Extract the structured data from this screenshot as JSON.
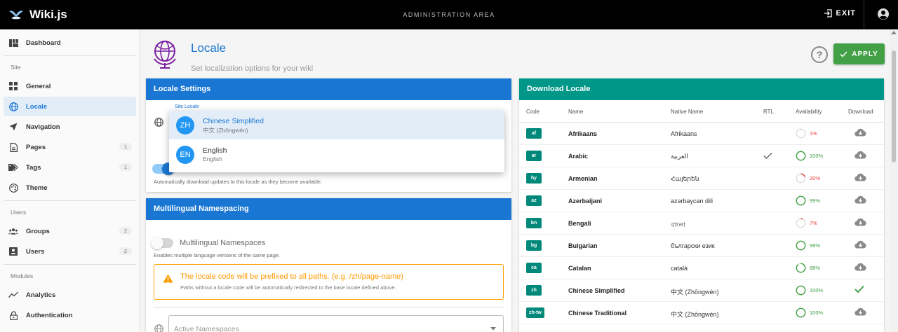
{
  "app": {
    "name": "Wiki.js",
    "area_title": "ADMINISTRATION AREA",
    "exit_label": "EXIT"
  },
  "sidebar": {
    "dashboard": "Dashboard",
    "site_header": "Site",
    "site_items": [
      {
        "label": "General",
        "icon": "general-icon"
      },
      {
        "label": "Locale",
        "icon": "globe-icon",
        "active": true
      },
      {
        "label": "Navigation",
        "icon": "navigation-icon"
      },
      {
        "label": "Pages",
        "icon": "page-icon",
        "badge": "1"
      },
      {
        "label": "Tags",
        "icon": "tag-icon",
        "badge": "1"
      },
      {
        "label": "Theme",
        "icon": "palette-icon"
      }
    ],
    "users_header": "Users",
    "users_items": [
      {
        "label": "Groups",
        "icon": "groups-icon",
        "badge": "2"
      },
      {
        "label": "Users",
        "icon": "user-card-icon",
        "badge": "2"
      }
    ],
    "modules_header": "Modules",
    "modules_items": [
      {
        "label": "Analytics",
        "icon": "analytics-icon"
      },
      {
        "label": "Authentication",
        "icon": "lock-icon"
      }
    ]
  },
  "page": {
    "title": "Locale",
    "subtitle": "Set localization options for your wiki",
    "help_label": "?",
    "apply_label": "APPLY"
  },
  "locale_settings": {
    "header": "Locale Settings",
    "site_locale_label": "Site Locale",
    "auto_update_hint": "Automatically download updates to this locale as they become available."
  },
  "dropdown": {
    "options": [
      {
        "code": "ZH",
        "name": "Chinese Simplified",
        "native": "中文 (Zhōngwén)",
        "selected": true
      },
      {
        "code": "EN",
        "name": "English",
        "native": "English",
        "selected": false
      }
    ]
  },
  "namespacing": {
    "header": "Multilingual Namespacing",
    "toggle_label": "Multilingual Namespaces",
    "toggle_hint": "Enables multiple language versions of the same page.",
    "warning_title": "The locale code will be prefixed to all paths. (e.g. /zh/page-name)",
    "warning_sub": "Paths without a locale code will be automatically redirected to the base locale defined above.",
    "active_placeholder": "Active Namespaces"
  },
  "download": {
    "header": "Download Locale",
    "columns": {
      "code": "Code",
      "name": "Name",
      "native": "Native Name",
      "rtl": "RTL",
      "availability": "Availability",
      "download": "Download"
    },
    "rows": [
      {
        "code": "af",
        "name": "Afrikaans",
        "native": "Afrikaans",
        "rtl": false,
        "availability": 1,
        "pct": "1%",
        "installed": false
      },
      {
        "code": "ar",
        "name": "Arabic",
        "native": "العربية",
        "rtl": true,
        "availability": 100,
        "pct": "100%",
        "installed": false
      },
      {
        "code": "hy",
        "name": "Armenian",
        "native": "Հայերեն",
        "rtl": false,
        "availability": 20,
        "pct": "20%",
        "installed": false
      },
      {
        "code": "az",
        "name": "Azerbaijani",
        "native": "azərbaycan dili",
        "rtl": false,
        "availability": 99,
        "pct": "99%",
        "installed": false
      },
      {
        "code": "bn",
        "name": "Bengali",
        "native": "বাংলা",
        "rtl": false,
        "availability": 7,
        "pct": "7%",
        "installed": false
      },
      {
        "code": "bg",
        "name": "Bulgarian",
        "native": "български език",
        "rtl": false,
        "availability": 99,
        "pct": "99%",
        "installed": false
      },
      {
        "code": "ca",
        "name": "Catalan",
        "native": "català",
        "rtl": false,
        "availability": 88,
        "pct": "88%",
        "installed": false
      },
      {
        "code": "zh",
        "name": "Chinese Simplified",
        "native": "中文 (Zhōngwén)",
        "rtl": false,
        "availability": 100,
        "pct": "100%",
        "installed": true
      },
      {
        "code": "zh-tw",
        "name": "Chinese Traditional",
        "native": "中文 (Zhōngwén)",
        "rtl": false,
        "availability": 100,
        "pct": "100%",
        "installed": false
      }
    ]
  },
  "colors": {
    "primary": "#1976d2",
    "teal": "#009688",
    "green": "#43a047",
    "warn": "#ff9800",
    "low": "#e53935"
  }
}
